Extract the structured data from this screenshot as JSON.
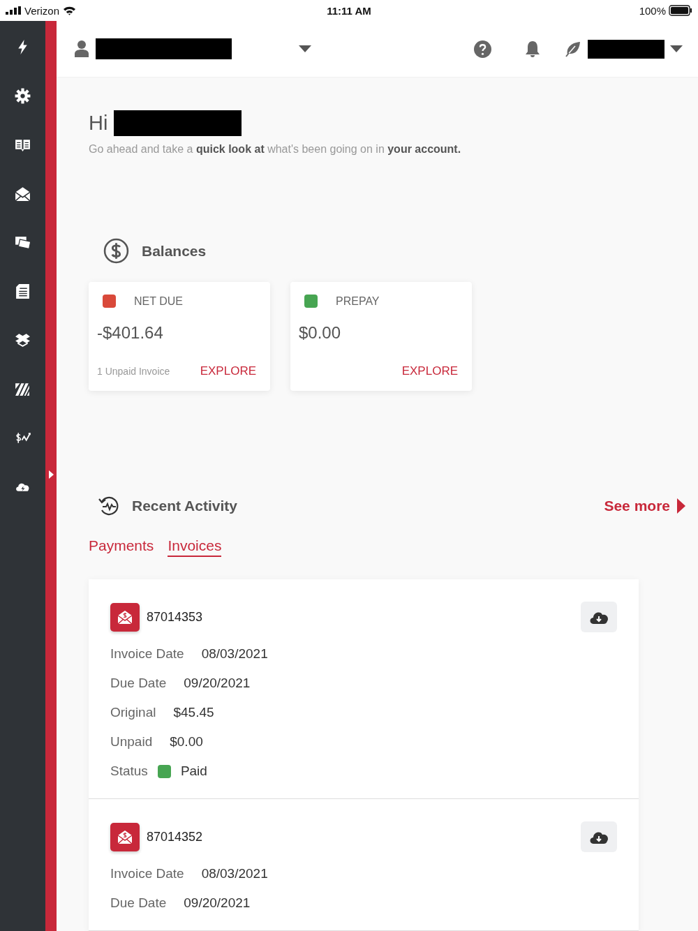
{
  "status_bar": {
    "carrier": "Verizon",
    "time": "11:11 AM",
    "battery": "100%"
  },
  "greeting": {
    "label": "Hi",
    "message": "Go ahead and take a **quick look at** what's been going on in **your account.**"
  },
  "balances": {
    "title": "Balances",
    "cards": [
      {
        "label": "NET DUE",
        "color": "#d9493a",
        "amount": "-$401.64",
        "note": "1 Unpaid Invoice",
        "action": "EXPLORE"
      },
      {
        "label": "PREPAY",
        "color": "#47a552",
        "amount": "$0.00",
        "action": "EXPLORE"
      }
    ]
  },
  "recent_activity": {
    "title": "Recent Activity",
    "see_more": "See more",
    "tabs": [
      {
        "label": "Payments",
        "selected": false
      },
      {
        "label": "Invoices",
        "selected": true
      }
    ],
    "invoices": [
      {
        "number": "87014353",
        "fields": [
          {
            "label": "Invoice Date",
            "value": "08/03/2021"
          },
          {
            "label": "Due Date",
            "value": "09/20/2021"
          },
          {
            "label": "Original",
            "value": "$45.45"
          },
          {
            "label": "Unpaid",
            "value": "$0.00"
          }
        ],
        "status": {
          "label": "Status",
          "value": "Paid",
          "color": "#47a552"
        }
      },
      {
        "number": "87014352",
        "fields": [
          {
            "label": "Invoice Date",
            "value": "08/03/2021"
          },
          {
            "label": "Due Date",
            "value": "09/20/2021"
          }
        ]
      }
    ]
  }
}
